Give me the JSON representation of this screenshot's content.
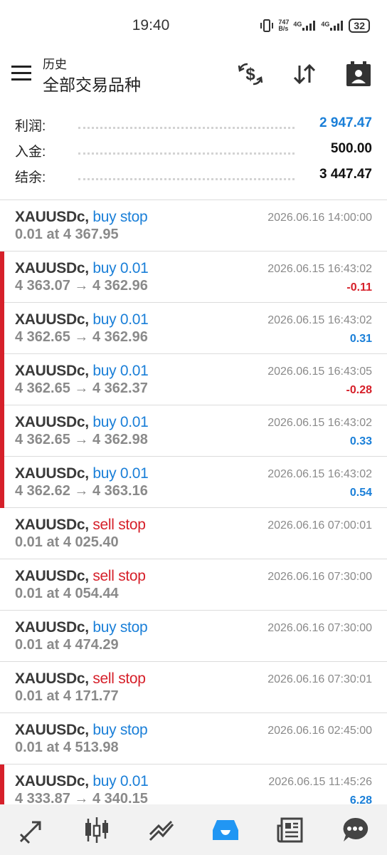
{
  "status": {
    "time": "19:40",
    "net_speed_top": "747",
    "net_speed_bottom": "B/s",
    "sig1": "4G",
    "sig2": "4G",
    "battery": "32"
  },
  "appbar": {
    "subtitle": "历史",
    "title": "全部交易品种",
    "actions": [
      "currency-exchange-icon",
      "sort-icon",
      "calendar-icon"
    ]
  },
  "summary": [
    {
      "label": "利润:",
      "value": "2 947.47",
      "color": "#1a7fd8"
    },
    {
      "label": "入金:",
      "value": "500.00"
    },
    {
      "label": "结余:",
      "value": "3 447.47"
    }
  ],
  "orders": [
    {
      "symbol": "XAUUSDc,",
      "type": "buy stop",
      "side": "buy",
      "price": "0.01 at 4 367.95",
      "time": "2026.06.16 14:00:00",
      "profit": "",
      "deal": false
    },
    {
      "symbol": "XAUUSDc,",
      "type": "buy 0.01",
      "side": "buy",
      "price": "4 363.07 → 4 362.96",
      "time": "2026.06.15 16:43:02",
      "profit": "-0.11",
      "deal": true
    },
    {
      "symbol": "XAUUSDc,",
      "type": "buy 0.01",
      "side": "buy",
      "price": "4 362.65 → 4 362.96",
      "time": "2026.06.15 16:43:02",
      "profit": "0.31",
      "deal": true
    },
    {
      "symbol": "XAUUSDc,",
      "type": "buy 0.01",
      "side": "buy",
      "price": "4 362.65 → 4 362.37",
      "time": "2026.06.15 16:43:05",
      "profit": "-0.28",
      "deal": true
    },
    {
      "symbol": "XAUUSDc,",
      "type": "buy 0.01",
      "side": "buy",
      "price": "4 362.65 → 4 362.98",
      "time": "2026.06.15 16:43:02",
      "profit": "0.33",
      "deal": true
    },
    {
      "symbol": "XAUUSDc,",
      "type": "buy 0.01",
      "side": "buy",
      "price": "4 362.62 → 4 363.16",
      "time": "2026.06.15 16:43:02",
      "profit": "0.54",
      "deal": true
    },
    {
      "symbol": "XAUUSDc,",
      "type": "sell stop",
      "side": "sell",
      "price": "0.01 at 4 025.40",
      "time": "2026.06.16 07:00:01",
      "profit": "",
      "deal": false
    },
    {
      "symbol": "XAUUSDc,",
      "type": "sell stop",
      "side": "sell",
      "price": "0.01 at 4 054.44",
      "time": "2026.06.16 07:30:00",
      "profit": "",
      "deal": false
    },
    {
      "symbol": "XAUUSDc,",
      "type": "buy stop",
      "side": "buy",
      "price": "0.01 at 4 474.29",
      "time": "2026.06.16 07:30:00",
      "profit": "",
      "deal": false
    },
    {
      "symbol": "XAUUSDc,",
      "type": "sell stop",
      "side": "sell",
      "price": "0.01 at 4 171.77",
      "time": "2026.06.16 07:30:01",
      "profit": "",
      "deal": false
    },
    {
      "symbol": "XAUUSDc,",
      "type": "buy stop",
      "side": "buy",
      "price": "0.01 at 4 513.98",
      "time": "2026.06.16 02:45:00",
      "profit": "",
      "deal": false
    },
    {
      "symbol": "XAUUSDc,",
      "type": "buy 0.01",
      "side": "buy",
      "price": "4 333.87 → 4 340.15",
      "time": "2026.06.15 11:45:26",
      "profit": "6.28",
      "deal": true
    }
  ],
  "bottom_nav": [
    {
      "icon": "quotes-icon",
      "active": false
    },
    {
      "icon": "chart-icon",
      "active": false
    },
    {
      "icon": "trade-icon",
      "active": false
    },
    {
      "icon": "history-icon",
      "active": true
    },
    {
      "icon": "news-icon",
      "active": false
    },
    {
      "icon": "messages-icon",
      "active": false
    }
  ],
  "colors": {
    "accent": "#1a7fd8",
    "sell": "#d6202a",
    "active_nav": "#2196f3"
  }
}
